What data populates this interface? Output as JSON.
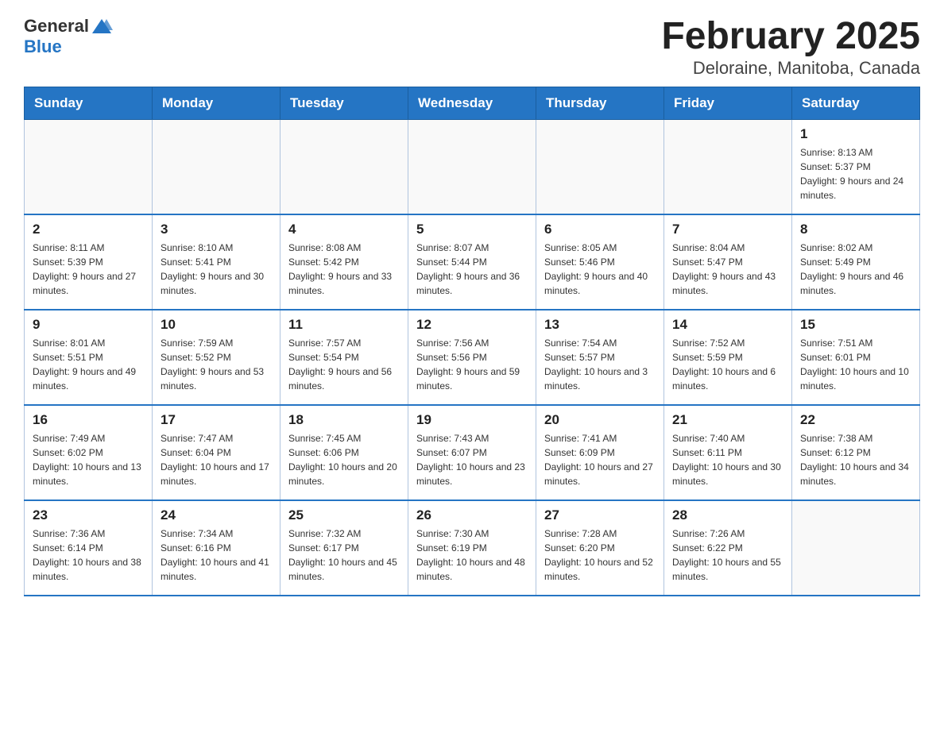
{
  "logo": {
    "text_general": "General",
    "text_blue": "Blue"
  },
  "title": "February 2025",
  "subtitle": "Deloraine, Manitoba, Canada",
  "weekdays": [
    "Sunday",
    "Monday",
    "Tuesday",
    "Wednesday",
    "Thursday",
    "Friday",
    "Saturday"
  ],
  "rows": [
    [
      {
        "day": "",
        "info": ""
      },
      {
        "day": "",
        "info": ""
      },
      {
        "day": "",
        "info": ""
      },
      {
        "day": "",
        "info": ""
      },
      {
        "day": "",
        "info": ""
      },
      {
        "day": "",
        "info": ""
      },
      {
        "day": "1",
        "info": "Sunrise: 8:13 AM\nSunset: 5:37 PM\nDaylight: 9 hours and 24 minutes."
      }
    ],
    [
      {
        "day": "2",
        "info": "Sunrise: 8:11 AM\nSunset: 5:39 PM\nDaylight: 9 hours and 27 minutes."
      },
      {
        "day": "3",
        "info": "Sunrise: 8:10 AM\nSunset: 5:41 PM\nDaylight: 9 hours and 30 minutes."
      },
      {
        "day": "4",
        "info": "Sunrise: 8:08 AM\nSunset: 5:42 PM\nDaylight: 9 hours and 33 minutes."
      },
      {
        "day": "5",
        "info": "Sunrise: 8:07 AM\nSunset: 5:44 PM\nDaylight: 9 hours and 36 minutes."
      },
      {
        "day": "6",
        "info": "Sunrise: 8:05 AM\nSunset: 5:46 PM\nDaylight: 9 hours and 40 minutes."
      },
      {
        "day": "7",
        "info": "Sunrise: 8:04 AM\nSunset: 5:47 PM\nDaylight: 9 hours and 43 minutes."
      },
      {
        "day": "8",
        "info": "Sunrise: 8:02 AM\nSunset: 5:49 PM\nDaylight: 9 hours and 46 minutes."
      }
    ],
    [
      {
        "day": "9",
        "info": "Sunrise: 8:01 AM\nSunset: 5:51 PM\nDaylight: 9 hours and 49 minutes."
      },
      {
        "day": "10",
        "info": "Sunrise: 7:59 AM\nSunset: 5:52 PM\nDaylight: 9 hours and 53 minutes."
      },
      {
        "day": "11",
        "info": "Sunrise: 7:57 AM\nSunset: 5:54 PM\nDaylight: 9 hours and 56 minutes."
      },
      {
        "day": "12",
        "info": "Sunrise: 7:56 AM\nSunset: 5:56 PM\nDaylight: 9 hours and 59 minutes."
      },
      {
        "day": "13",
        "info": "Sunrise: 7:54 AM\nSunset: 5:57 PM\nDaylight: 10 hours and 3 minutes."
      },
      {
        "day": "14",
        "info": "Sunrise: 7:52 AM\nSunset: 5:59 PM\nDaylight: 10 hours and 6 minutes."
      },
      {
        "day": "15",
        "info": "Sunrise: 7:51 AM\nSunset: 6:01 PM\nDaylight: 10 hours and 10 minutes."
      }
    ],
    [
      {
        "day": "16",
        "info": "Sunrise: 7:49 AM\nSunset: 6:02 PM\nDaylight: 10 hours and 13 minutes."
      },
      {
        "day": "17",
        "info": "Sunrise: 7:47 AM\nSunset: 6:04 PM\nDaylight: 10 hours and 17 minutes."
      },
      {
        "day": "18",
        "info": "Sunrise: 7:45 AM\nSunset: 6:06 PM\nDaylight: 10 hours and 20 minutes."
      },
      {
        "day": "19",
        "info": "Sunrise: 7:43 AM\nSunset: 6:07 PM\nDaylight: 10 hours and 23 minutes."
      },
      {
        "day": "20",
        "info": "Sunrise: 7:41 AM\nSunset: 6:09 PM\nDaylight: 10 hours and 27 minutes."
      },
      {
        "day": "21",
        "info": "Sunrise: 7:40 AM\nSunset: 6:11 PM\nDaylight: 10 hours and 30 minutes."
      },
      {
        "day": "22",
        "info": "Sunrise: 7:38 AM\nSunset: 6:12 PM\nDaylight: 10 hours and 34 minutes."
      }
    ],
    [
      {
        "day": "23",
        "info": "Sunrise: 7:36 AM\nSunset: 6:14 PM\nDaylight: 10 hours and 38 minutes."
      },
      {
        "day": "24",
        "info": "Sunrise: 7:34 AM\nSunset: 6:16 PM\nDaylight: 10 hours and 41 minutes."
      },
      {
        "day": "25",
        "info": "Sunrise: 7:32 AM\nSunset: 6:17 PM\nDaylight: 10 hours and 45 minutes."
      },
      {
        "day": "26",
        "info": "Sunrise: 7:30 AM\nSunset: 6:19 PM\nDaylight: 10 hours and 48 minutes."
      },
      {
        "day": "27",
        "info": "Sunrise: 7:28 AM\nSunset: 6:20 PM\nDaylight: 10 hours and 52 minutes."
      },
      {
        "day": "28",
        "info": "Sunrise: 7:26 AM\nSunset: 6:22 PM\nDaylight: 10 hours and 55 minutes."
      },
      {
        "day": "",
        "info": ""
      }
    ]
  ]
}
